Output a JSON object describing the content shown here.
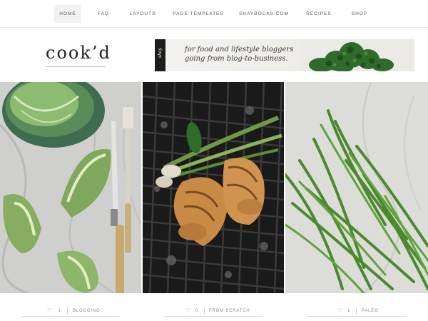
{
  "nav": {
    "items": [
      {
        "label": "HOME",
        "active": true
      },
      {
        "label": "FAQ"
      },
      {
        "label": "LAYOUTS"
      },
      {
        "label": "PAGE TEMPLATES"
      },
      {
        "label": "SHAYBOCKS.COM"
      },
      {
        "label": "RECIPES"
      },
      {
        "label": "SHOP"
      }
    ]
  },
  "header": {
    "logo": "cook’d"
  },
  "banner": {
    "tag": "shay",
    "line1": "for food and lifestyle bloggers",
    "line2": "going from blog-to-business."
  },
  "posts": [
    {
      "likes": "1",
      "category": "BLOGGING",
      "image": "cabbage-knife-fork"
    },
    {
      "likes": "0",
      "category": "FROM SCRATCH",
      "image": "grilled-chicken"
    },
    {
      "likes": "1",
      "category": "PALEO",
      "image": "green-beans"
    }
  ],
  "colors": {
    "nav_active_bg": "#f1f1f1",
    "banner_tag_bg": "#1d1d1d",
    "kale_green": "#2f6b2a"
  }
}
